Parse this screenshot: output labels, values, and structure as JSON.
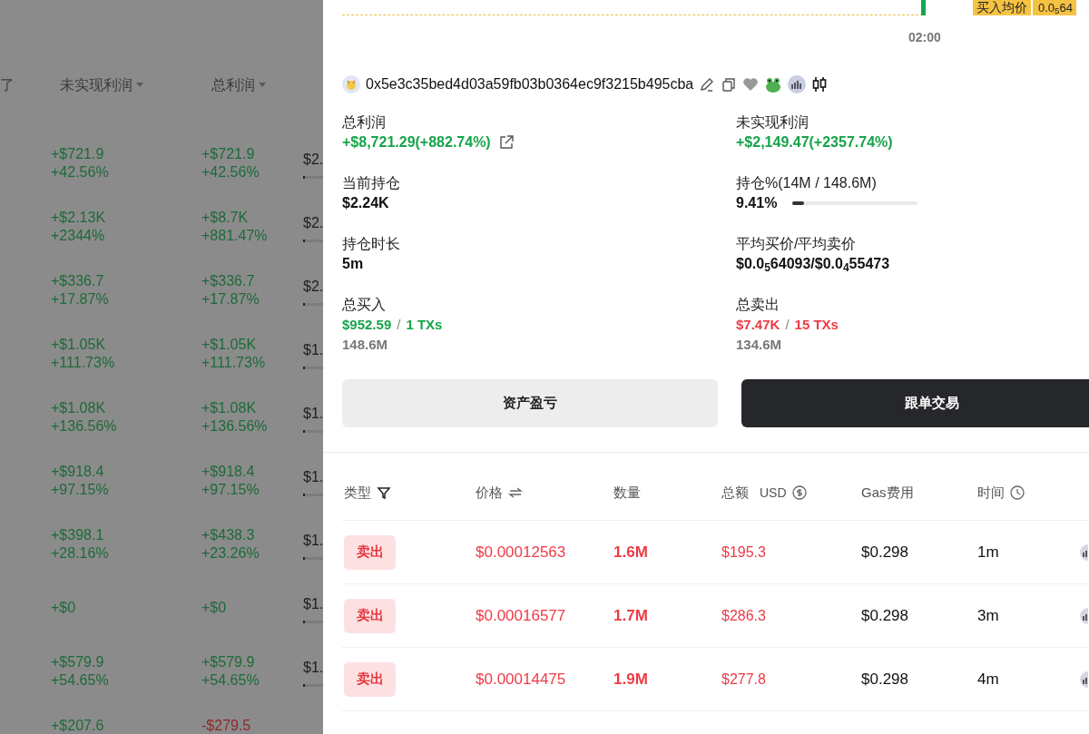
{
  "background_table": {
    "columns": [
      {
        "label": "了",
        "sortable": false
      },
      {
        "label": "未实现利润",
        "sortable": true
      },
      {
        "label": "总利润",
        "sortable": true
      }
    ],
    "rows": [
      {
        "unrealized": {
          "value": "+$721.9",
          "percent": "+42.56%",
          "negative": false
        },
        "total": {
          "value": "+$721.9",
          "percent": "+42.56%",
          "negative": false
        },
        "holding": "$2."
      },
      {
        "unrealized": {
          "value": "+$2.13K",
          "percent": "+2344%",
          "negative": false
        },
        "total": {
          "value": "+$8.7K",
          "percent": "+881.47%",
          "negative": false
        },
        "holding": "$2."
      },
      {
        "unrealized": {
          "value": "+$336.7",
          "percent": "+17.87%",
          "negative": false
        },
        "total": {
          "value": "+$336.7",
          "percent": "+17.87%",
          "negative": false
        },
        "holding": "$2."
      },
      {
        "unrealized": {
          "value": "+$1.05K",
          "percent": "+111.73%",
          "negative": false
        },
        "total": {
          "value": "+$1.05K",
          "percent": "+111.73%",
          "negative": false
        },
        "holding": "$1."
      },
      {
        "unrealized": {
          "value": "+$1.08K",
          "percent": "+136.56%",
          "negative": false
        },
        "total": {
          "value": "+$1.08K",
          "percent": "+136.56%",
          "negative": false
        },
        "holding": "$1."
      },
      {
        "unrealized": {
          "value": "+$918.4",
          "percent": "+97.15%",
          "negative": false
        },
        "total": {
          "value": "+$918.4",
          "percent": "+97.15%",
          "negative": false
        },
        "holding": "$1."
      },
      {
        "unrealized": {
          "value": "+$398.1",
          "percent": "+28.16%",
          "negative": false
        },
        "total": {
          "value": "+$438.3",
          "percent": "+23.26%",
          "negative": false
        },
        "holding": "$1."
      },
      {
        "unrealized": {
          "value": "+$0",
          "negative": false
        },
        "total": {
          "value": "+$0",
          "negative": false
        },
        "holding": "$1."
      },
      {
        "unrealized": {
          "value": "+$579.9",
          "percent": "+54.65%",
          "negative": false
        },
        "total": {
          "value": "+$579.9",
          "percent": "+54.65%",
          "negative": false
        },
        "holding": "$1."
      },
      {
        "unrealized": {
          "value": "+$207.6",
          "negative": false
        },
        "total": {
          "value": "-$279.5",
          "negative": true
        }
      }
    ]
  },
  "drawer": {
    "chart": {
      "time_label": "02:00",
      "avg_buy_label": "买入均价",
      "avg_buy_value": "0.0$_{5}$64"
    },
    "wallet": {
      "address": "0x5e3c35bed4d03a59fb03b0364ec9f3215b495cba"
    },
    "stats": [
      {
        "kind": "link",
        "label": "总利润",
        "value": "+$8,721.29(+882.74%)",
        "color": "#17a34a"
      },
      {
        "kind": "plain",
        "label": "未实现利润",
        "value": "+$2,149.47(+2357.74%)",
        "color": "#17a34a"
      },
      {
        "kind": "plain",
        "label": "当前持仓",
        "value": "$2.24K",
        "color": "#111111"
      },
      {
        "kind": "bar",
        "label": "持仓%(14M / 148.6M)",
        "value": "9.41%",
        "color": "#111111",
        "level": 0.0941
      },
      {
        "kind": "plain",
        "label": "持仓时长",
        "value": "5m",
        "color": "#111111"
      },
      {
        "kind": "plain",
        "label": "平均买价/平均卖价",
        "value": "$0.0$_{5}$64093/$0.0$_{4}$55473",
        "color": "#111111"
      },
      {
        "kind": "trades",
        "label": "总买入",
        "value": "$952.59",
        "separator": "/",
        "count": "1 TXs",
        "sub": "148.6M",
        "color": "#17a34a"
      },
      {
        "kind": "trades",
        "label": "总卖出",
        "value": "$7.47K",
        "separator": "/",
        "count": "15 TXs",
        "sub": "134.6M",
        "color": "#ef3a46"
      }
    ],
    "buttons": [
      {
        "label": "资产盈亏",
        "kind": "secondary"
      },
      {
        "label": "跟单交易",
        "kind": "primary"
      }
    ],
    "trades": {
      "columns": [
        {
          "label": "类型"
        },
        {
          "label": "价格"
        },
        {
          "label": "数量"
        },
        {
          "label": "总额",
          "unit": "USD"
        },
        {
          "label": "Gas费用"
        },
        {
          "label": "时间"
        }
      ],
      "rows": [
        {
          "kind": "sell",
          "type": "卖出",
          "price": "$0.00012563",
          "amount": "1.6M",
          "total": "$195.3",
          "gas": "$0.298",
          "time": "1m"
        },
        {
          "kind": "sell",
          "type": "卖出",
          "price": "$0.00016577",
          "amount": "1.7M",
          "total": "$286.3",
          "gas": "$0.298",
          "time": "3m"
        },
        {
          "kind": "sell",
          "type": "卖出",
          "price": "$0.00014475",
          "amount": "1.9M",
          "total": "$277.8",
          "gas": "$0.298",
          "time": "4m"
        }
      ]
    }
  }
}
